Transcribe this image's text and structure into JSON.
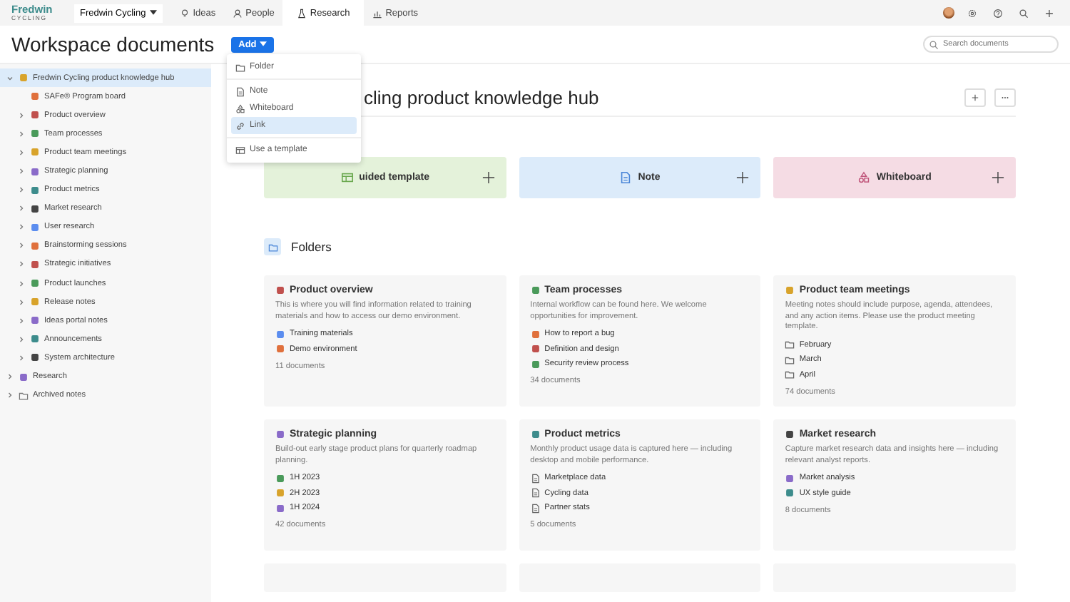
{
  "logo": {
    "top": "Fredwin",
    "bottom": "CYCLING"
  },
  "workspace": "Fredwin Cycling",
  "nav_tabs": [
    {
      "label": "Ideas",
      "kind": "bulb",
      "selected": false
    },
    {
      "label": "People",
      "kind": "person",
      "selected": false
    },
    {
      "label": "Research",
      "kind": "flask",
      "selected": true
    },
    {
      "label": "Reports",
      "kind": "chart",
      "selected": false
    }
  ],
  "page_title": "Workspace documents",
  "add_button": "Add",
  "search": {
    "placeholder": "Search documents"
  },
  "add_menu": [
    [
      {
        "label": "Folder",
        "kind": "folder",
        "selected": false
      }
    ],
    [
      {
        "label": "Note",
        "kind": "doc",
        "selected": false
      },
      {
        "label": "Whiteboard",
        "kind": "shapes",
        "selected": false
      },
      {
        "label": "Link",
        "kind": "link",
        "selected": true
      }
    ],
    [
      {
        "label": "Use a template",
        "kind": "template",
        "selected": false
      }
    ]
  ],
  "sidebar": [
    {
      "label": "Fredwin Cycling product knowledge hub",
      "kind": "branch",
      "expanded": true,
      "selected": true,
      "children": [
        {
          "label": "SAFe® Program board",
          "kind": "leaf",
          "selected": false
        },
        {
          "label": "Product overview",
          "kind": "branch",
          "expanded": false,
          "selected": false
        },
        {
          "label": "Team processes",
          "kind": "branch",
          "expanded": false,
          "selected": false
        },
        {
          "label": "Product team meetings",
          "kind": "branch",
          "expanded": false,
          "selected": false
        },
        {
          "label": "Strategic planning",
          "kind": "branch",
          "expanded": false,
          "selected": false
        },
        {
          "label": "Product metrics",
          "kind": "branch",
          "expanded": false,
          "selected": false
        },
        {
          "label": "Market research",
          "kind": "branch",
          "expanded": false,
          "selected": false
        },
        {
          "label": "User research",
          "kind": "branch",
          "expanded": false,
          "selected": false
        },
        {
          "label": "Brainstorming sessions",
          "kind": "branch",
          "expanded": false,
          "selected": false
        },
        {
          "label": "Strategic initiatives",
          "kind": "branch",
          "expanded": false,
          "selected": false
        },
        {
          "label": "Product launches",
          "kind": "branch",
          "expanded": false,
          "selected": false
        },
        {
          "label": "Release notes",
          "kind": "branch",
          "expanded": false,
          "selected": false
        },
        {
          "label": "Ideas portal notes",
          "kind": "branch",
          "expanded": false,
          "selected": false
        },
        {
          "label": "Announcements",
          "kind": "branch",
          "expanded": false,
          "selected": false
        },
        {
          "label": "System architecture",
          "kind": "branch",
          "expanded": false,
          "selected": false
        }
      ]
    },
    {
      "label": "Research",
      "kind": "branch",
      "expanded": false,
      "selected": false
    },
    {
      "label": "Archived notes",
      "kind": "branch",
      "expanded": false,
      "selected": false
    }
  ],
  "hub_title": "cling product knowledge hub",
  "quick_add": [
    {
      "label": "uided template",
      "kind": "template",
      "color": "#e4f2da"
    },
    {
      "label": "Note",
      "kind": "doc",
      "color": "#dcebfa"
    },
    {
      "label": "Whiteboard",
      "kind": "shapes",
      "color": "#f5dce4"
    }
  ],
  "folders_heading": "Folders",
  "folders": [
    {
      "kind": "card",
      "title": "Product overview",
      "description": "This is where you will find information related to training materials and how to access our demo environment.",
      "items": [
        {
          "label": "Training materials",
          "kind": "emoji"
        },
        {
          "label": "Demo environment",
          "kind": "emoji"
        }
      ],
      "count": "11 documents"
    },
    {
      "kind": "card",
      "title": "Team processes",
      "description": "Internal workflow can be found here. We welcome opportunities for improvement.",
      "items": [
        {
          "label": "How to report a bug",
          "kind": "emoji"
        },
        {
          "label": "Definition and design",
          "kind": "emoji"
        },
        {
          "label": "Security review process",
          "kind": "emoji"
        }
      ],
      "count": "34 documents"
    },
    {
      "kind": "card",
      "title": "Product team meetings",
      "description": "Meeting notes should include purpose, agenda, attendees, and any action items. Please use the product meeting template.",
      "items": [
        {
          "label": "February",
          "kind": "folder"
        },
        {
          "label": "March",
          "kind": "folder"
        },
        {
          "label": "April",
          "kind": "folder"
        }
      ],
      "count": "74 documents"
    },
    {
      "kind": "card",
      "title": "Strategic planning",
      "description": "Build-out early stage product plans for quarterly roadmap planning.",
      "items": [
        {
          "label": "1H 2023",
          "kind": "emoji"
        },
        {
          "label": "2H 2023",
          "kind": "emoji"
        },
        {
          "label": "1H 2024",
          "kind": "emoji"
        }
      ],
      "count": "42 documents"
    },
    {
      "kind": "card",
      "title": "Product metrics",
      "description": "Monthly product usage data is captured here — including desktop and mobile performance.",
      "items": [
        {
          "label": "Marketplace data",
          "kind": "doc"
        },
        {
          "label": "Cycling data",
          "kind": "doc"
        },
        {
          "label": "Partner stats",
          "kind": "doc"
        }
      ],
      "count": "5 documents"
    },
    {
      "kind": "card",
      "title": "Market research",
      "description": "Capture market research data and insights here — including relevant analyst reports.",
      "items": [
        {
          "label": "Market analysis",
          "kind": "emoji"
        },
        {
          "label": "UX style guide",
          "kind": "emoji"
        }
      ],
      "count": "8 documents"
    },
    {
      "kind": "cut"
    },
    {
      "kind": "cut"
    },
    {
      "kind": "cut"
    }
  ]
}
